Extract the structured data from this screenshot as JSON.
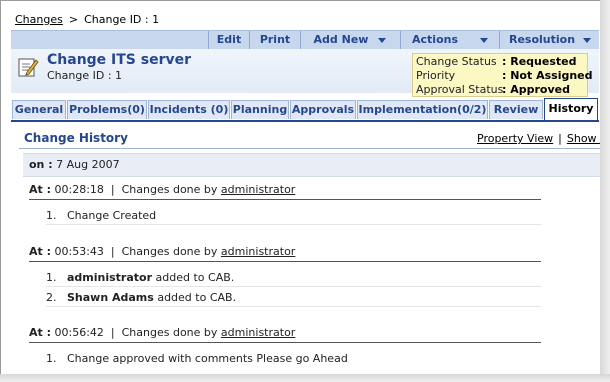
{
  "breadcrumb": {
    "root": "Changes",
    "separator": ">",
    "current": "Change ID : 1"
  },
  "toolbar": {
    "edit": "Edit",
    "print": "Print",
    "add_new": "Add New",
    "actions": "Actions",
    "resolution": "Resolution"
  },
  "change": {
    "title": "Change ITS server",
    "id_label": "Change ID : 1"
  },
  "status": {
    "rows": [
      {
        "label": "Change Status",
        "value": ": Requested"
      },
      {
        "label": "Priority",
        "value": ": Not Assigned"
      },
      {
        "label": "Approval Status",
        "value": ": Approved"
      }
    ]
  },
  "tabs": [
    "General",
    "Problems(0)",
    "Incidents (0)",
    "Planning",
    "Approvals",
    "Implementation(0/2)",
    "Review",
    "History"
  ],
  "history": {
    "title": "Change History",
    "property_view": "Property View",
    "link_sep": "|",
    "show_all": "Show All",
    "date_label": "on :",
    "date": "7 Aug 2007",
    "at_label": "At :",
    "pipe": "|",
    "changes_by": "Changes done by",
    "entries": [
      {
        "time": "00:28:18",
        "user": "administrator",
        "items": [
          {
            "num": "1.",
            "bold": "",
            "text": "Change Created"
          }
        ]
      },
      {
        "time": "00:53:43",
        "user": "administrator",
        "items": [
          {
            "num": "1.",
            "bold": "administrator",
            "text": " added to CAB."
          },
          {
            "num": "2.",
            "bold": "Shawn Adams",
            "text": " added to CAB."
          }
        ]
      },
      {
        "time": "00:56:42",
        "user": "administrator",
        "items": [
          {
            "num": "1.",
            "bold": "",
            "text": "Change approved with comments Please go Ahead"
          }
        ]
      }
    ]
  }
}
